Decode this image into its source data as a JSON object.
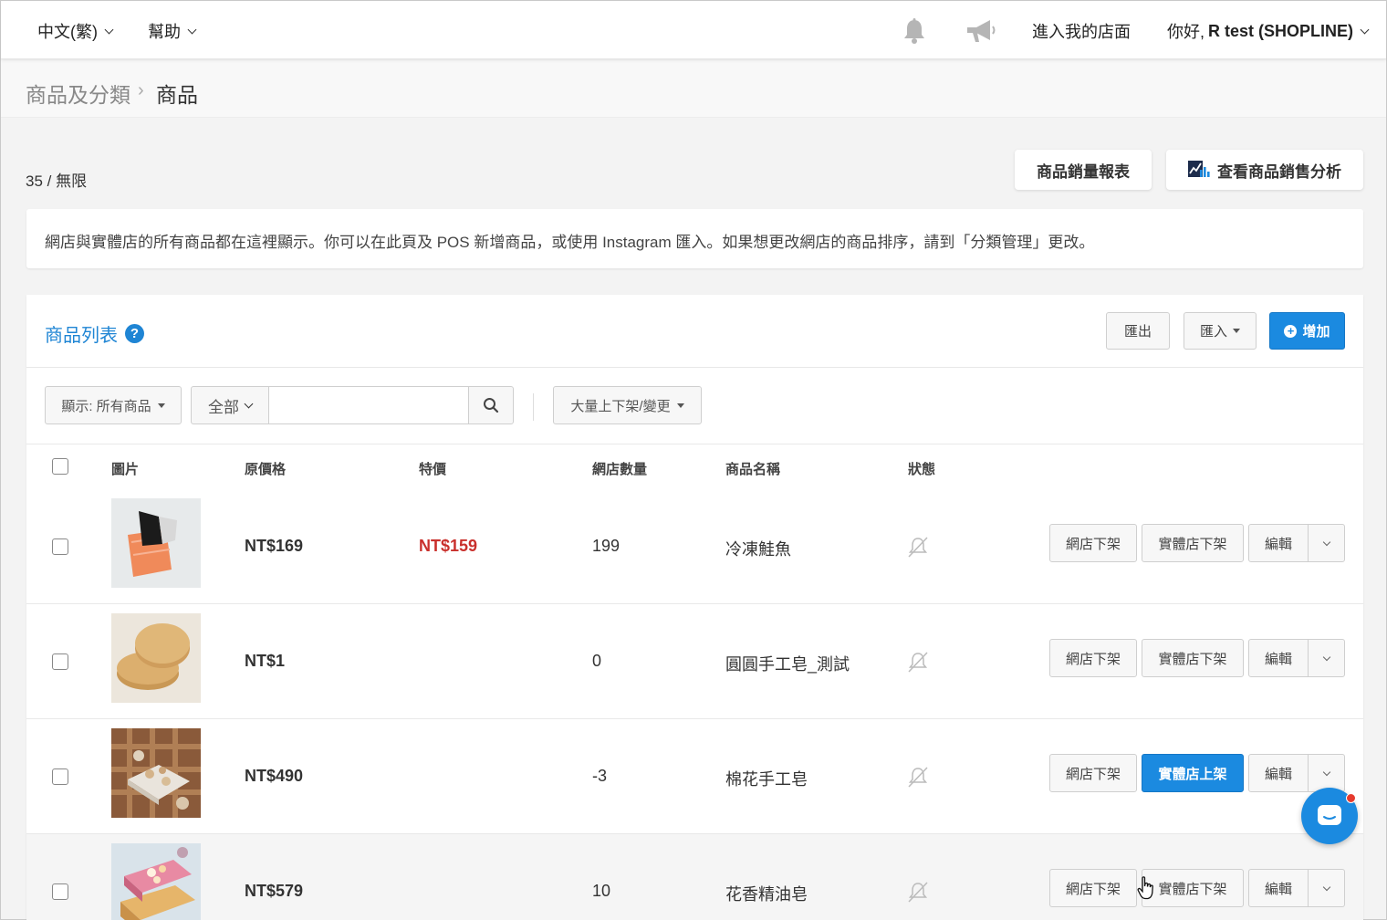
{
  "topbar": {
    "language": "中文(繁)",
    "help": "幫助",
    "enter_store": "進入我的店面",
    "greeting_prefix": "你好, ",
    "greeting_name": "R test (SHOPLINE)"
  },
  "breadcrumb": {
    "parent": "商品及分類",
    "separator": "›",
    "current": "商品"
  },
  "summary": {
    "count": "35 / 無限",
    "sales_report_button": "商品銷量報表",
    "sales_analysis_button": "查看商品銷售分析"
  },
  "notice": "網店與實體店的所有商品都在這裡顯示。你可以在此頁及 POS 新增商品，或使用 Instagram 匯入。如果想更改網店的商品排序，請到「分類管理」更改。",
  "panel": {
    "title": "商品列表",
    "help_icon": "?",
    "export_button": "匯出",
    "import_button": "匯入",
    "add_button": "增加"
  },
  "filters": {
    "display_label": "顯示: 所有商品",
    "scope_label": "全部",
    "search_value": "",
    "bulk_label": "大量上下架/變更"
  },
  "table": {
    "headers": {
      "image": "圖片",
      "original_price": "原價格",
      "special_price": "特價",
      "online_qty": "網店數量",
      "name": "商品名稱",
      "status": "狀態"
    },
    "rows": [
      {
        "price": "NT$169",
        "sale": "NT$159",
        "qty": "199",
        "name": "冷凍鮭魚",
        "online_action": "網店下架",
        "store_action": "實體店下架",
        "store_action_primary": false,
        "edit": "編輯",
        "thumb": "salmon"
      },
      {
        "price": "NT$1",
        "sale": "",
        "qty": "0",
        "name": "圓圓手工皂_測試",
        "online_action": "網店下架",
        "store_action": "實體店下架",
        "store_action_primary": false,
        "edit": "編輯",
        "thumb": "round-soap"
      },
      {
        "price": "NT$490",
        "sale": "",
        "qty": "-3",
        "name": "棉花手工皂",
        "online_action": "網店下架",
        "store_action": "實體店上架",
        "store_action_primary": true,
        "edit": "編輯",
        "thumb": "cotton-soap"
      },
      {
        "price": "NT$579",
        "sale": "",
        "qty": "10",
        "name": "花香精油皂",
        "online_action": "網店下架",
        "store_action": "實體店下架",
        "store_action_primary": false,
        "edit": "編輯",
        "thumb": "floral-soap"
      }
    ]
  },
  "colors": {
    "accent": "#1b8ae0",
    "link": "#1f85d4",
    "sale": "#c9302c",
    "badge": "#e63b2e"
  },
  "icons": {
    "bell": "bell-icon",
    "announcement": "megaphone-icon",
    "analysis": "chart-icon",
    "search": "search-icon",
    "status": "notification-off-icon",
    "chat": "chat-icon"
  }
}
